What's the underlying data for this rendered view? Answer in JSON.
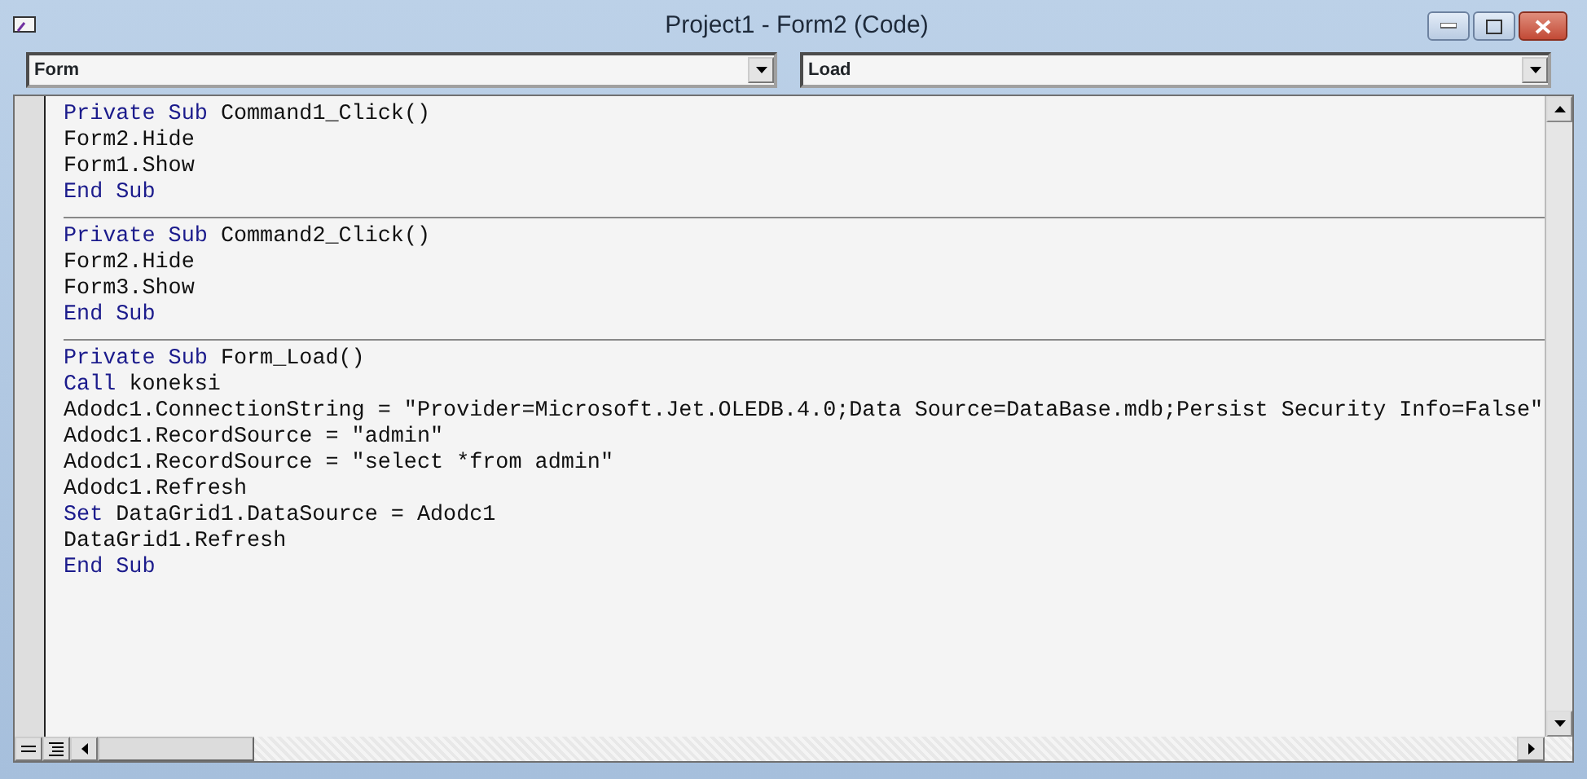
{
  "window": {
    "title": "Project1 - Form2 (Code)"
  },
  "object_combo": {
    "value": "Form"
  },
  "procedure_combo": {
    "value": "Load"
  },
  "procedures": [
    {
      "lines": [
        [
          {
            "text": "Private Sub",
            "keyword": true
          },
          {
            "text": " Command1_Click()",
            "keyword": false
          }
        ],
        [
          {
            "text": "Form2.Hide",
            "keyword": false
          }
        ],
        [
          {
            "text": "Form1.Show",
            "keyword": false
          }
        ],
        [
          {
            "text": "End Sub",
            "keyword": true
          }
        ]
      ]
    },
    {
      "lines": [
        [
          {
            "text": "Private Sub",
            "keyword": true
          },
          {
            "text": " Command2_Click()",
            "keyword": false
          }
        ],
        [
          {
            "text": "Form2.Hide",
            "keyword": false
          }
        ],
        [
          {
            "text": "Form3.Show",
            "keyword": false
          }
        ],
        [
          {
            "text": "End Sub",
            "keyword": true
          }
        ]
      ]
    },
    {
      "lines": [
        [
          {
            "text": "Private Sub",
            "keyword": true
          },
          {
            "text": " Form_Load()",
            "keyword": false
          }
        ],
        [
          {
            "text": "Call",
            "keyword": true
          },
          {
            "text": " koneksi",
            "keyword": false
          }
        ],
        [
          {
            "text": "Adodc1.ConnectionString = \"Provider=Microsoft.Jet.OLEDB.4.0;Data Source=DataBase.mdb;Persist Security Info=False\"",
            "keyword": false
          }
        ],
        [
          {
            "text": "Adodc1.RecordSource = \"admin\"",
            "keyword": false
          }
        ],
        [
          {
            "text": "Adodc1.RecordSource = \"select *from admin\"",
            "keyword": false
          }
        ],
        [
          {
            "text": "Adodc1.Refresh",
            "keyword": false
          }
        ],
        [
          {
            "text": "Set",
            "keyword": true
          },
          {
            "text": " DataGrid1.DataSource = Adodc1",
            "keyword": false
          }
        ],
        [
          {
            "text": "DataGrid1.Refresh",
            "keyword": false
          }
        ],
        [
          {
            "text": "End Sub",
            "keyword": true
          }
        ]
      ]
    }
  ]
}
